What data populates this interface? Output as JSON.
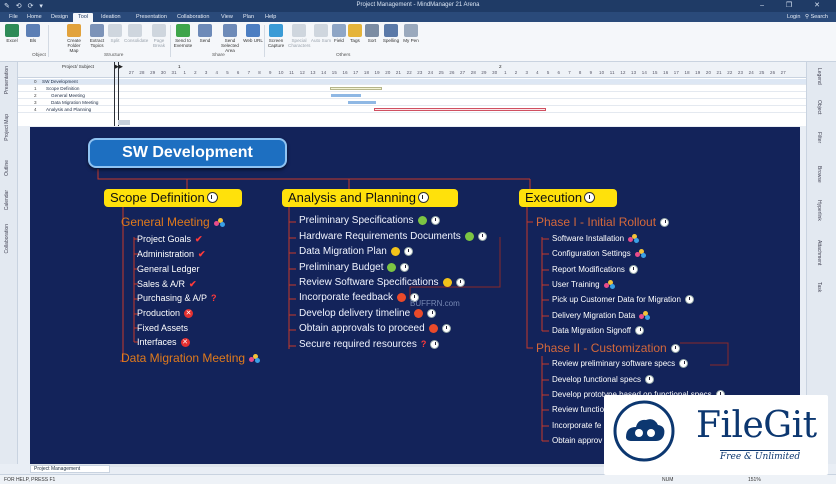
{
  "window": {
    "title": "Project Management - MindManager 21 Arena",
    "controls": "–  ❐  ✕"
  },
  "tabs": [
    "File",
    "Home",
    "Design",
    "Tool",
    "Ideation",
    "Presentation",
    "Collaboration",
    "View",
    "Plan",
    "Help"
  ],
  "active_tab": "Tool",
  "login": "Login",
  "search_label": "Search",
  "ribbon": {
    "buttons": [
      "Excel",
      "Bls",
      "Create Folder Map",
      "Extract Topics",
      "Split",
      "Consolidate",
      "Page Break",
      "Send to Evernote",
      "Send",
      "Send Selected Area",
      "Web URL",
      "Screen Capture",
      "Special Characters",
      "Auto Sum",
      "Field",
      "Tags",
      "Sort",
      "Spelling",
      "My Pen"
    ],
    "groups": [
      "Object",
      "Structure",
      "Share",
      "Others"
    ]
  },
  "gantt": {
    "column_header": "Project/ Subject",
    "ticks": [
      "27",
      "28",
      "29",
      "30",
      "31",
      "1",
      "2",
      "3",
      "4",
      "5",
      "6",
      "7",
      "8",
      "9",
      "10",
      "11",
      "12",
      "13",
      "14",
      "15",
      "16",
      "17",
      "18",
      "19",
      "20",
      "21",
      "22",
      "23",
      "24",
      "25",
      "26",
      "27",
      "28",
      "29",
      "30",
      "1",
      "2",
      "3",
      "4",
      "5",
      "6",
      "7",
      "8",
      "9",
      "10",
      "11",
      "12",
      "13",
      "14",
      "15",
      "16",
      "17",
      "18",
      "19",
      "20",
      "21",
      "22",
      "23",
      "24",
      "25",
      "26",
      "27"
    ],
    "month_markers": [
      "1",
      "2"
    ],
    "rows": [
      {
        "num": "0",
        "name": "SW Development"
      },
      {
        "num": "1",
        "name": "Scope Definition"
      },
      {
        "num": "2",
        "name": "General Meeting"
      },
      {
        "num": "3",
        "name": "Data Migration Meeting"
      },
      {
        "num": "4",
        "name": "Analysis and Planning"
      }
    ]
  },
  "left_dock": [
    "Presentation",
    "Project Map",
    "Outline",
    "Calendar",
    "Collaboration"
  ],
  "right_dock": [
    "Legend",
    "Object",
    "Filter",
    "Browse",
    "Hyperlink",
    "Attachment",
    "Task"
  ],
  "map": {
    "root": "SW Development",
    "scope": {
      "title": "Scope Definition",
      "general_meeting": "General Meeting",
      "items": [
        "Project Goals",
        "Administration",
        "General Ledger",
        "Sales & A/R",
        "Purchasing & A/P",
        "Production",
        "Fixed Assets",
        "Interfaces"
      ],
      "data_migration_meeting": "Data Migration Meeting"
    },
    "analysis": {
      "title": "Analysis and Planning",
      "items": [
        "Preliminary Specifications",
        "Hardware Requirements Documents",
        "Data Migration Plan",
        "Preliminary Budget",
        "Review Software Specifications",
        "Incorporate feedback",
        "Develop delivery timeline",
        "Obtain approvals to proceed",
        "Secure required resources"
      ]
    },
    "execution": {
      "title": "Execution",
      "phase1": "Phase I - Initial Rollout",
      "phase1_items": [
        "Software Installation",
        "Configuration Settings",
        "Report Modifications",
        "User Training",
        "Pick up Customer Data for Migration",
        "Delivery Migration Data",
        "Data Migration Signoff"
      ],
      "phase2": "Phase II - Customization",
      "phase2_items": [
        "Review preliminary software specs",
        "Develop functional specs",
        "Develop prototype based on functional specs",
        "Review functio",
        "Incorporate fe",
        "Obtain approv"
      ]
    }
  },
  "overlay_watermark": "BUFFRN.com",
  "doc_tab": "Project Management",
  "status": {
    "left": "FOR HELP, PRESS F1",
    "num": "NUM",
    "zoom": "151%"
  },
  "filegit": {
    "name": "FileGit",
    "tagline": "Free & Unlimited"
  },
  "colors": {
    "canvas_bg": "#13235a",
    "branch_yellow": "#ffe10b",
    "root_blue": "#1d6fc1",
    "sub_orange": "#e07a1c",
    "link_red": "#c53a2b"
  }
}
